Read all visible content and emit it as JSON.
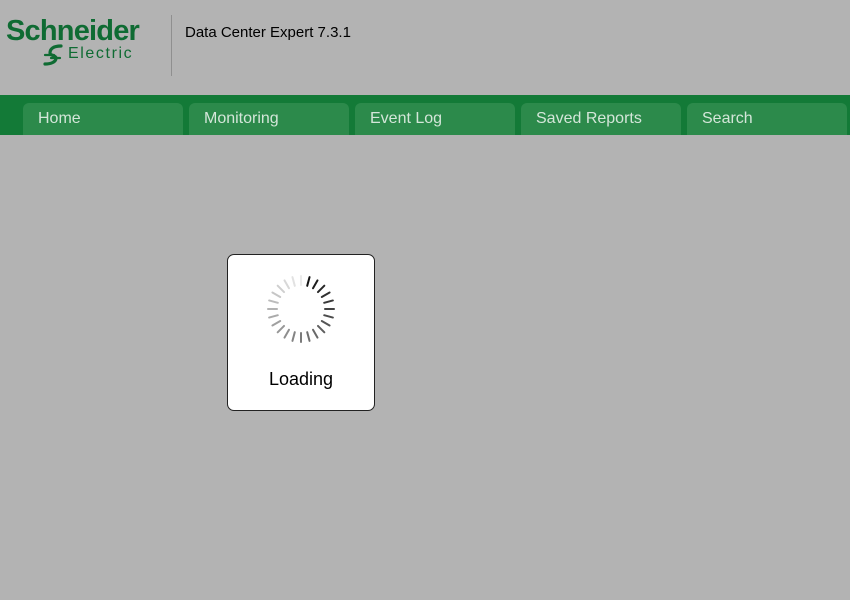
{
  "brand": {
    "name_line1": "Schneider",
    "name_line2": "Electric",
    "color": "#0f6b33"
  },
  "product": {
    "title": "Data Center Expert 7.3.1"
  },
  "nav": {
    "bar_color": "#137a37",
    "tab_color": "#2c8a4b",
    "tabs": [
      {
        "label": "Home"
      },
      {
        "label": "Monitoring"
      },
      {
        "label": "Event Log"
      },
      {
        "label": "Saved Reports"
      },
      {
        "label": "Search"
      }
    ]
  },
  "loading": {
    "label": "Loading",
    "icon": "spinner-icon"
  }
}
